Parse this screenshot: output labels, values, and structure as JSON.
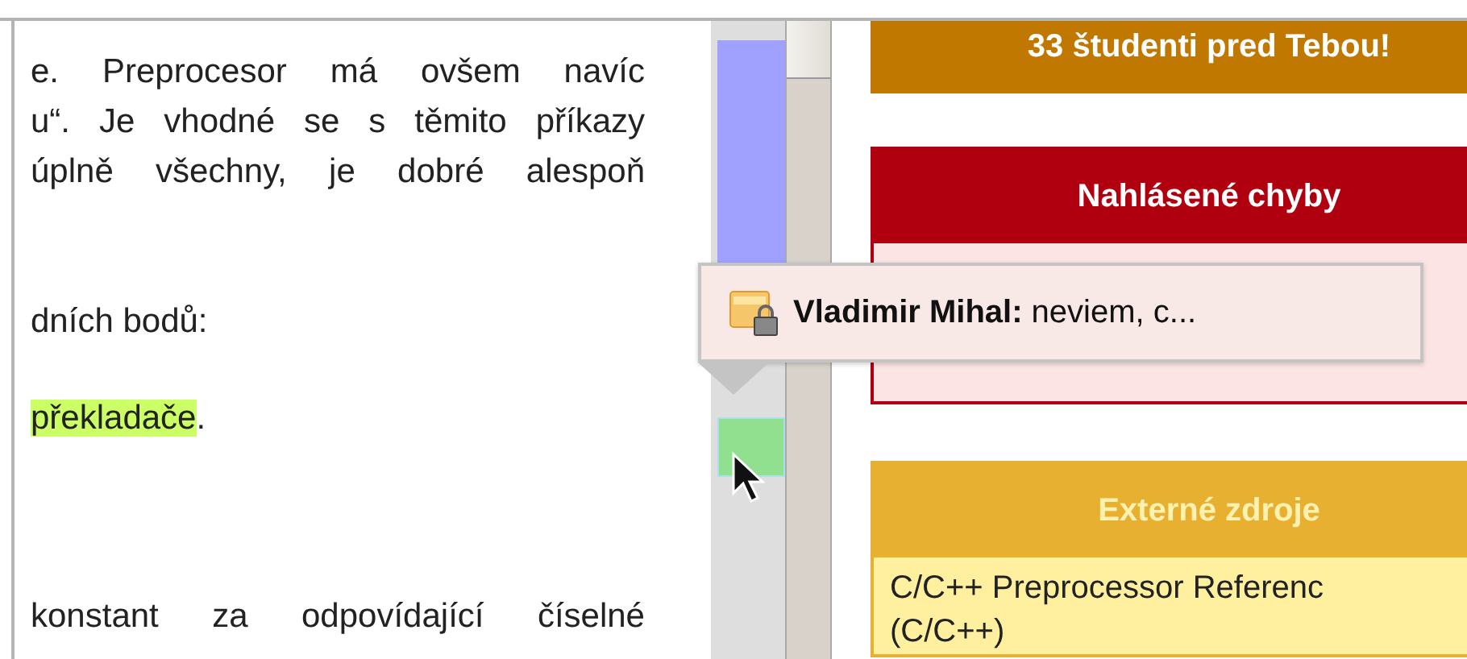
{
  "document": {
    "paragraphs": [
      {
        "lines": [
          {
            "justified": true,
            "segments": [
              {
                "text": "e. Preprocesor má ovšem navíc",
                "highlighted": false
              }
            ]
          },
          {
            "justified": true,
            "segments": [
              {
                "text": "u“. Je vhodné se s těmito příkazy",
                "highlighted": false
              }
            ]
          },
          {
            "justified": true,
            "segments": [
              {
                "text": "úplně všechny, je dobré alespoň",
                "highlighted": false
              }
            ]
          }
        ]
      },
      {
        "lines": [
          {
            "justified": false,
            "segments": [
              {
                "text": "dních bodů:",
                "highlighted": false
              }
            ]
          }
        ]
      },
      {
        "lines": [
          {
            "segments": [
              {
                "text": "překladače",
                "highlighted": true
              },
              {
                "text": ".",
                "highlighted": false
              }
            ]
          }
        ]
      },
      {
        "lines": [
          {
            "justified": true,
            "segments": [
              {
                "text": "konstant za odpovídající číselné",
                "highlighted": false
              }
            ]
          }
        ]
      }
    ]
  },
  "markers": [
    {
      "color": "#a0a0ff"
    },
    {
      "color": "#90e090"
    }
  ],
  "sidebar": {
    "boxes": [
      {
        "title": "33 študenti pred Tebou!",
        "color": "#c07800"
      },
      {
        "title": "Nahlásené chyby",
        "color": "#b0000f"
      },
      {
        "title": "Externé zdroje",
        "color": "#e8b030",
        "items": [
          "C/C++ Preprocessor Referenc",
          "(C/C++)"
        ]
      }
    ]
  },
  "tooltip": {
    "text": "**Vladimir Mihal:** neviem, c..."
  }
}
